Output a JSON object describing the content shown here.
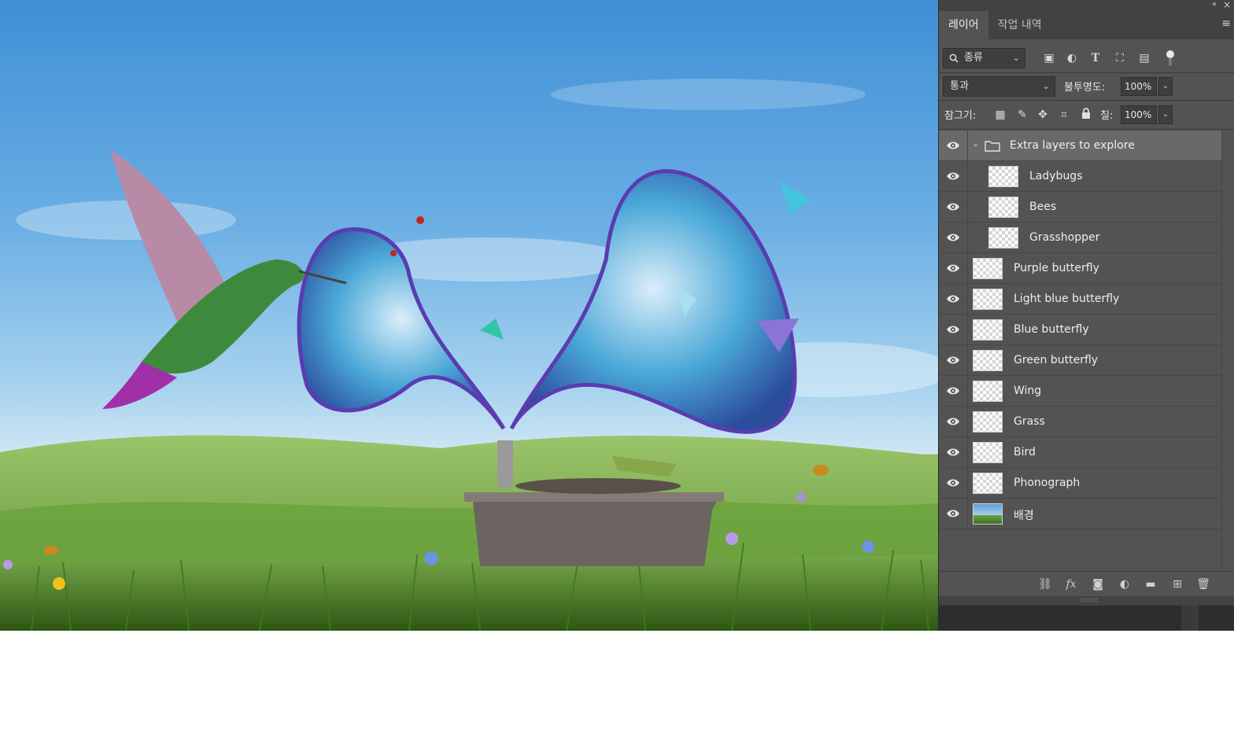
{
  "panel": {
    "tabs": [
      {
        "label": "레이어",
        "active": true
      },
      {
        "label": "작업 내역",
        "active": false
      }
    ],
    "filter": {
      "kind_label": "종류"
    },
    "blend": {
      "mode": "통과",
      "opacity_label": "불투명도:",
      "opacity_value": "100%"
    },
    "lock": {
      "label": "잠그기:",
      "fill_label": "칠:",
      "fill_value": "100%"
    },
    "layers": [
      {
        "name": "Extra layers to explore",
        "type": "group",
        "selected": true
      },
      {
        "name": "Ladybugs",
        "type": "layer",
        "indent": true
      },
      {
        "name": "Bees",
        "type": "layer",
        "indent": true
      },
      {
        "name": "Grasshopper",
        "type": "layer",
        "indent": true
      },
      {
        "name": "Purple butterfly",
        "type": "layer"
      },
      {
        "name": "Light blue butterfly",
        "type": "layer"
      },
      {
        "name": "Blue butterfly",
        "type": "layer"
      },
      {
        "name": "Green butterfly",
        "type": "layer"
      },
      {
        "name": "Wing",
        "type": "layer"
      },
      {
        "name": "Grass",
        "type": "layer"
      },
      {
        "name": "Bird",
        "type": "layer"
      },
      {
        "name": "Phonograph",
        "type": "layer"
      },
      {
        "name": "배경",
        "type": "background"
      }
    ],
    "bottom_icons": [
      "link-icon",
      "fx-icon",
      "mask-icon",
      "adjustment-icon",
      "folder-icon",
      "new-layer-icon",
      "trash-icon"
    ]
  },
  "colors": {
    "panel_bg": "#535353",
    "selected_row": "#696969",
    "sky_top": "#3f8fd6",
    "grass": "#5f9a33"
  }
}
